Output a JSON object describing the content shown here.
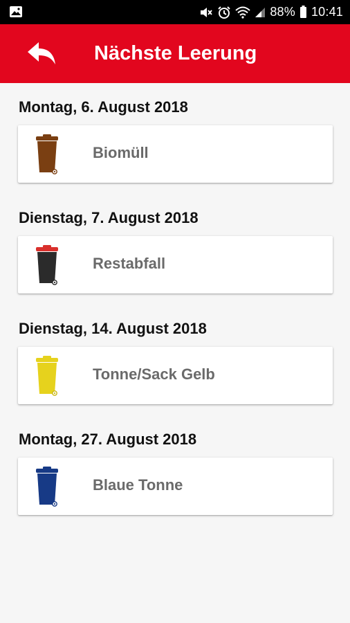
{
  "status_bar": {
    "battery": "88%",
    "time": "10:41",
    "icons": [
      "image-icon",
      "mute-icon",
      "alarm-icon",
      "wifi-icon",
      "signal-icon",
      "battery-icon"
    ]
  },
  "header": {
    "title": "Nächste Leerung",
    "back_icon": "back-arrow-icon",
    "background": "#e2061e"
  },
  "collections": [
    {
      "date": "Montag, 6. August 2018",
      "label": "Biomüll",
      "bin_color": "#7a3f12",
      "lid_color": "#7a3f12",
      "icon": "brown-bin-icon"
    },
    {
      "date": "Dienstag, 7. August 2018",
      "label": "Restabfall",
      "bin_color": "#2b2b2b",
      "lid_color": "#d9302c",
      "icon": "black-bin-icon"
    },
    {
      "date": "Dienstag, 14. August 2018",
      "label": "Tonne/Sack Gelb",
      "bin_color": "#e6d21d",
      "lid_color": "#e6d21d",
      "icon": "yellow-bin-icon"
    },
    {
      "date": "Montag, 27. August 2018",
      "label": "Blaue Tonne",
      "bin_color": "#173a86",
      "lid_color": "#173a86",
      "icon": "blue-bin-icon"
    }
  ]
}
